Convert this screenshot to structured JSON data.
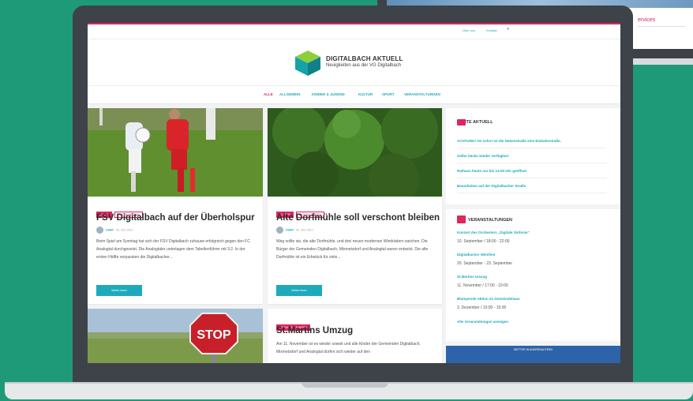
{
  "topbar": {
    "links": [
      "Über uns",
      "Kontakt"
    ]
  },
  "brand": {
    "title": "DIGITALBACH AKTUELL",
    "subtitle": "Neuigkeiten aus der VG Digitalbach"
  },
  "nav": {
    "items": [
      "ALLE",
      "ALLGEMEIN",
      "KINDER & JUGEND",
      "KULTUR",
      "SPORT",
      "VERANSTALTUNGEN"
    ]
  },
  "cards": [
    {
      "tags": [
        "SPORT",
        "DIGITALHAUSEN"
      ],
      "title": "FSV Digitalbach auf der Überholspur",
      "author": "USER",
      "date": "26. JULI 2017",
      "excerpt": "Beim Spiel am Sonntag hat sich der FSV Digitalbach zuhause erfolgreich gegen den FC Analogtal durchgesetzt. Die Analogtaler unterlagen dem Tabellenführer mit 3:2. In der ersten Hälfte verpassten die Digitalbacher...",
      "button": "Weiter lesen"
    },
    {
      "tags": [
        "KULTUR",
        "DIGITALHAUSEN"
      ],
      "title": "Alte Dorfmühle soll verschont bleiben",
      "author": "USER",
      "date": "26. JULI 2017",
      "excerpt": "Weg sollte sie, die alte Dorfmühle, und drei neuen modernen Windrädern weichen. Die Bürger der Gemeinden Digitalbach, Mixmetzdorf und Analogtal waren entsetzt. Die alte Dorfmühle ist ein Erbstück für viele...",
      "button": "Weiter lesen"
    },
    {
      "tags": [
        "VERANSTALTUNGEN"
      ],
      "title": "St.Martins Umzug",
      "excerpt": "Am 11. November ist es wieder soweit und alle Kinder der Gemeinden Digitalbach, Mixmetzdorf und Analogtal dürfen sich wieder auf den"
    }
  ],
  "widget_news": {
    "title": "HEUTE AKTUELL",
    "links": [
      "ACHTUNG! Ab sofort ist die Nebenstraße eine Einbahnstraße.",
      "Gelbe Säcke wieder verfügbar!",
      "Rathaus heute nur bis 14:00 Uhr geöffnet",
      "Bauarbeiten auf der Digitalbacher Straße"
    ]
  },
  "widget_events": {
    "title": "VERANSTALTUNGEN",
    "events": [
      {
        "name": "Konzert des Orchesters „Digitale Sinfonie“",
        "date": "10. September / 18:00 - 22:00"
      },
      {
        "name": "Digitalbacher Weinfest",
        "date": "20. September - 23. September"
      },
      {
        "name": "St.Martins Umzug",
        "date": "11. November / 17:00 - 19:00"
      },
      {
        "name": "Blutspende Aktion im Gemeindehaus",
        "date": "3. Dezember / 10:00 - 15:00"
      }
    ],
    "all_link": "Alle Veranstaltungen anzeigen"
  },
  "banner": {
    "text": "WETTER IN ANGERSAUTERN"
  },
  "sign": {
    "text": "STOP"
  },
  "colors": {
    "accent": "#e0245e",
    "link": "#1eaabc",
    "background": "#1f9a79"
  }
}
